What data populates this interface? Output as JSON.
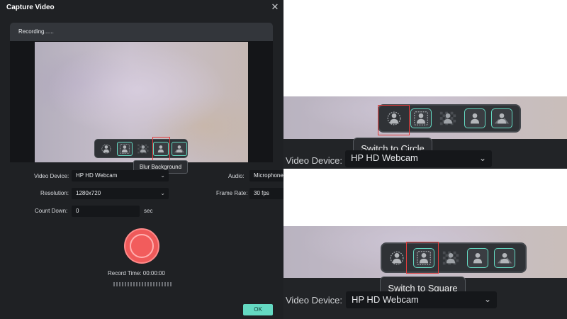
{
  "dialog": {
    "title": "Capture Video",
    "close_label": "✕",
    "recording_status": "Recording......",
    "tooltip": "Blur Background"
  },
  "form": {
    "video_device": {
      "label": "Video Device:",
      "value": "HP HD Webcam"
    },
    "audio": {
      "label": "Audio:",
      "value": "Microphone"
    },
    "resolution": {
      "label": "Resolution:",
      "value": "1280x720"
    },
    "frame_rate": {
      "label": "Frame Rate:",
      "value": "30 fps"
    },
    "count_down": {
      "label": "Count Down:",
      "value": "0",
      "unit": "sec"
    }
  },
  "record": {
    "time_text": "Record Time: 00:00:00"
  },
  "ok_label": "OK",
  "toolbar_buttons": [
    {
      "icon": "circle-frame-icon",
      "active": false
    },
    {
      "icon": "square-frame-icon",
      "active": true
    },
    {
      "icon": "person-transparent-icon",
      "active": false
    },
    {
      "icon": "blur-background-icon",
      "active": true
    },
    {
      "icon": "replace-background-icon",
      "active": true
    }
  ],
  "zoom_panels": [
    {
      "tooltip": "Switch to Circle",
      "highlighted_button": "circle-frame-icon",
      "video_device_label": "Video Device:",
      "video_device_value": "HP HD Webcam"
    },
    {
      "tooltip": "Switch to Square",
      "highlighted_button": "square-frame-icon",
      "video_device_label": "Video Device:",
      "video_device_value": "HP HD Webcam"
    }
  ],
  "colors": {
    "accent_teal": "#64d9c2",
    "record_red": "#ef5a5a",
    "highlight_red": "#e23c3c",
    "dialog_bg": "#1f2124"
  }
}
